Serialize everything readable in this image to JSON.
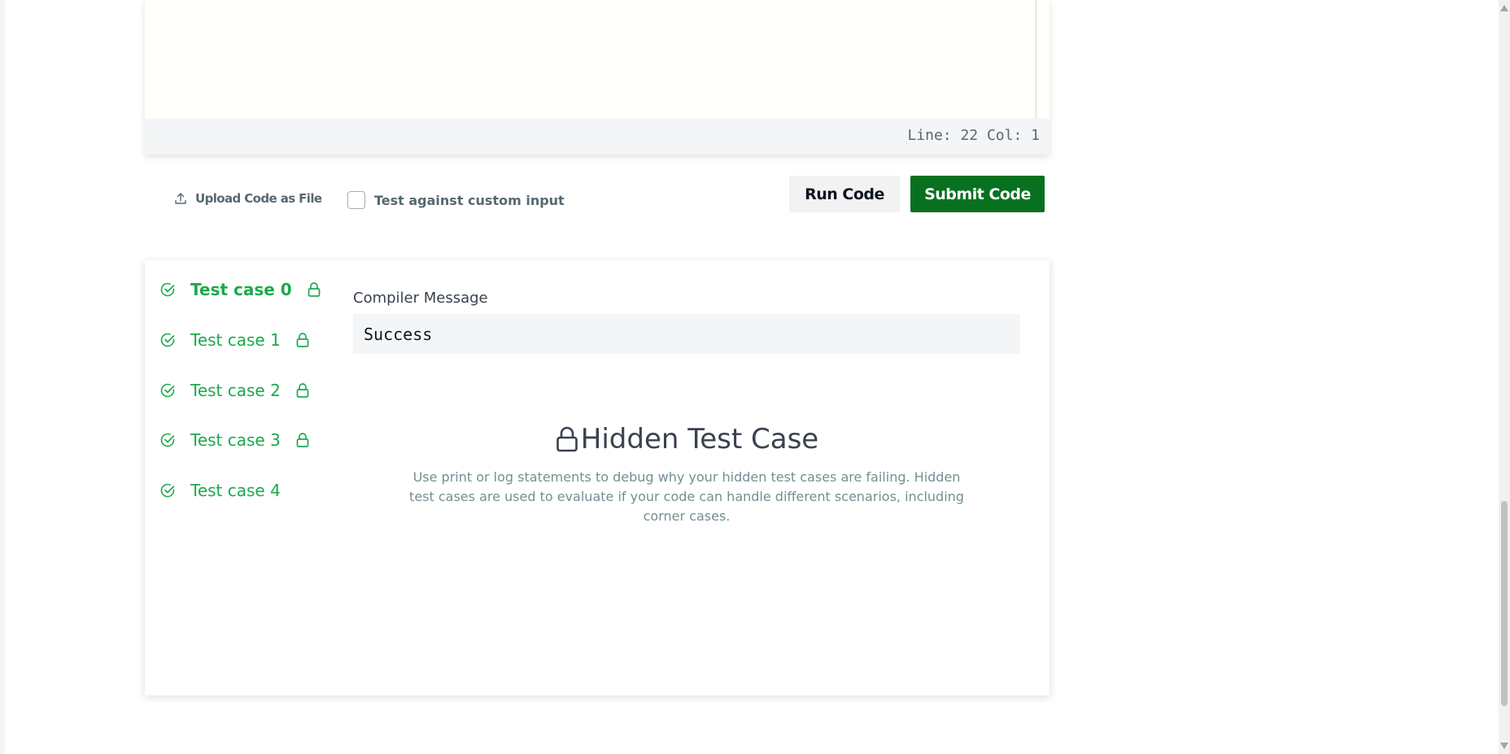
{
  "editor": {
    "cursor_position": "Line: 22 Col: 1"
  },
  "actions": {
    "upload_label": "Upload Code as File",
    "custom_input_label": "Test against custom input",
    "custom_input_checked": false,
    "run_label": "Run Code",
    "submit_label": "Submit Code"
  },
  "results": {
    "test_cases": [
      {
        "label": "Test case 0",
        "status": "passed",
        "locked": true,
        "active": true
      },
      {
        "label": "Test case 1",
        "status": "passed",
        "locked": true,
        "active": false
      },
      {
        "label": "Test case 2",
        "status": "passed",
        "locked": true,
        "active": false
      },
      {
        "label": "Test case 3",
        "status": "passed",
        "locked": true,
        "active": false
      },
      {
        "label": "Test case 4",
        "status": "passed",
        "locked": false,
        "active": false
      }
    ],
    "compiler_label": "Compiler Message",
    "compiler_message": "Success",
    "hidden_title": "Hidden Test Case",
    "hidden_description": "Use print or log statements to debug why your hidden test cases are failing. Hidden test cases are used to evaluate if your code can handle different scenarios, including corner cases."
  },
  "colors": {
    "success_green": "#1ba94c",
    "submit_green": "#08711f",
    "text_dark": "#39424e",
    "text_muted": "#738f93"
  },
  "icons": {
    "upload": "upload-icon",
    "check": "check-circle-icon",
    "lock": "lock-icon"
  }
}
